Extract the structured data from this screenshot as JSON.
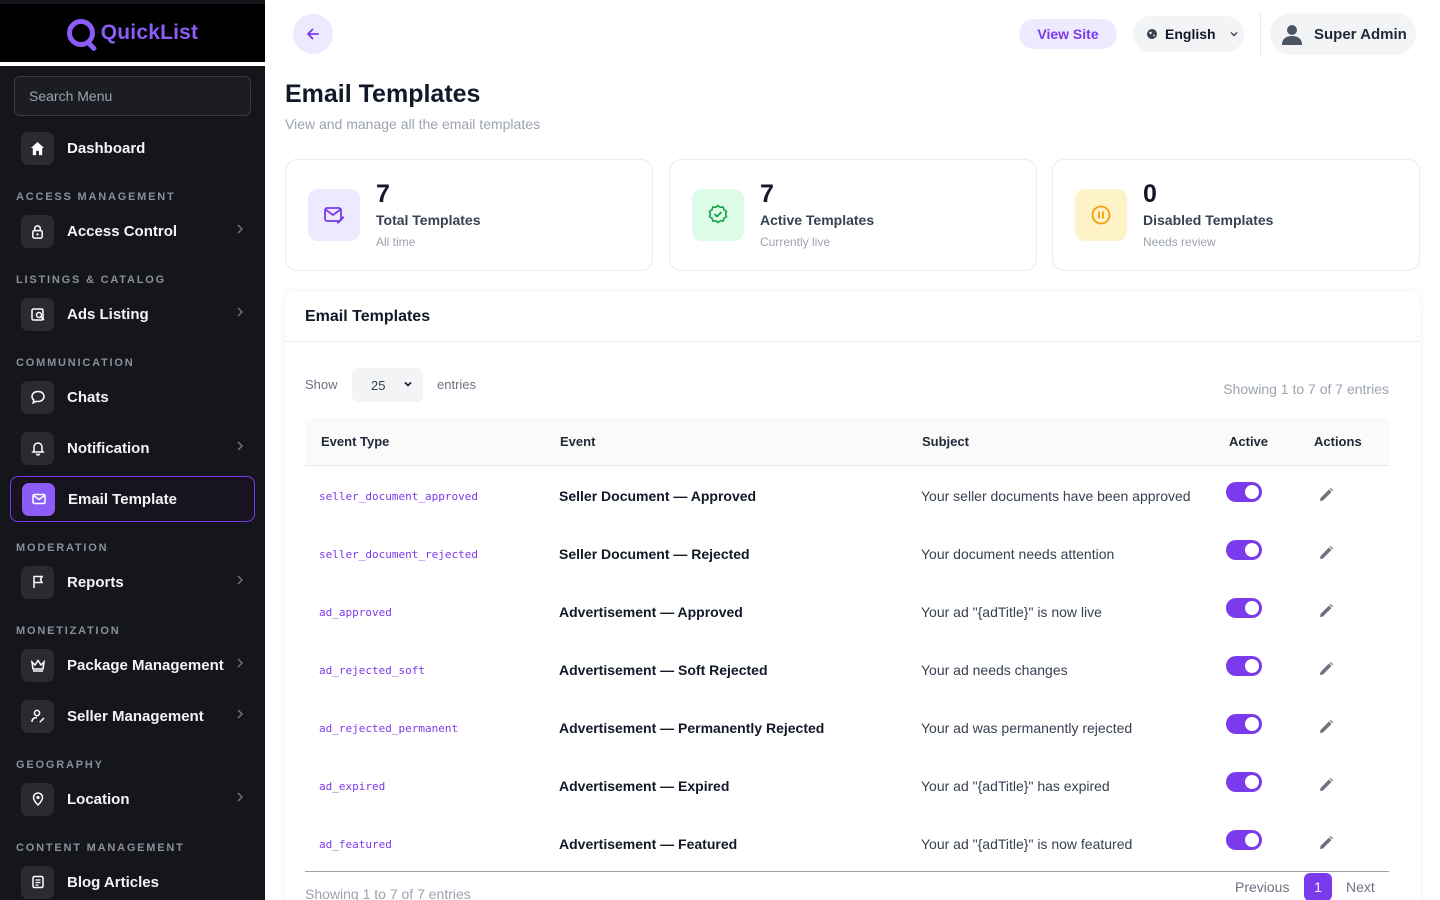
{
  "brand": {
    "name": "QuickList"
  },
  "sidebar": {
    "search_placeholder": "Search Menu",
    "items": [
      {
        "label": "Dashboard",
        "icon": "home-icon"
      },
      {
        "section": "ACCESS MANAGEMENT"
      },
      {
        "label": "Access Control",
        "icon": "lock-icon"
      },
      {
        "section": "LISTINGS & CATALOG"
      },
      {
        "label": "Ads Listing",
        "icon": "search-listing-icon"
      },
      {
        "section": "COMMUNICATION"
      },
      {
        "label": "Chats",
        "icon": "chat-icon"
      },
      {
        "label": "Notification",
        "icon": "bell-icon"
      },
      {
        "label": "Email Template",
        "icon": "mail-icon",
        "active": true
      },
      {
        "section": "MODERATION"
      },
      {
        "label": "Reports",
        "icon": "flag-icon"
      },
      {
        "section": "MONETIZATION"
      },
      {
        "label": "Package Management",
        "icon": "crown-icon"
      },
      {
        "label": "Seller Management",
        "icon": "user-edit-icon"
      },
      {
        "section": "GEOGRAPHY"
      },
      {
        "label": "Location",
        "icon": "location-pin-icon"
      },
      {
        "section": "CONTENT MANAGEMENT"
      },
      {
        "label": "Blog Articles",
        "icon": "blog-icon"
      }
    ]
  },
  "topbar": {
    "view_site": "View Site",
    "language": "English",
    "user_name": "Super Admin"
  },
  "header": {
    "title": "Email Templates",
    "subtitle": "View and manage all the email templates"
  },
  "stats": [
    {
      "value": "7",
      "label": "Total Templates",
      "sub": "All time",
      "color": "#7c3aed"
    },
    {
      "value": "7",
      "label": "Active Templates",
      "sub": "Currently live",
      "color": "#16a34a"
    },
    {
      "value": "0",
      "label": "Disabled Templates",
      "sub": "Needs review",
      "color": "#f59e0b"
    }
  ],
  "table": {
    "title": "Email Templates",
    "show_label": "Show",
    "entries_value": "25",
    "entries_label": "entries",
    "showing_text": "Showing 1 to 7 of 7 entries",
    "columns": [
      "Event Type",
      "Event",
      "Subject",
      "Active",
      "Actions"
    ],
    "rows": [
      {
        "event_type": "seller_document_approved",
        "event": "Seller Document — Approved",
        "subject": "Your seller documents have been approved",
        "active": true
      },
      {
        "event_type": "seller_document_rejected",
        "event": "Seller Document — Rejected",
        "subject": "Your document needs attention",
        "active": true
      },
      {
        "event_type": "ad_approved",
        "event": "Advertisement — Approved",
        "subject": "Your ad \"{adTitle}\" is now live",
        "active": true
      },
      {
        "event_type": "ad_rejected_soft",
        "event": "Advertisement — Soft Rejected",
        "subject": "Your ad needs changes",
        "active": true
      },
      {
        "event_type": "ad_rejected_permanent",
        "event": "Advertisement — Permanently Rejected",
        "subject": "Your ad was permanently rejected",
        "active": true
      },
      {
        "event_type": "ad_expired",
        "event": "Advertisement — Expired",
        "subject": "Your ad \"{adTitle}\" has expired",
        "active": true
      },
      {
        "event_type": "ad_featured",
        "event": "Advertisement — Featured",
        "subject": "Your ad \"{adTitle}\" is now featured",
        "active": true
      }
    ],
    "pagination": {
      "previous": "Previous",
      "current": "1",
      "next": "Next"
    }
  }
}
